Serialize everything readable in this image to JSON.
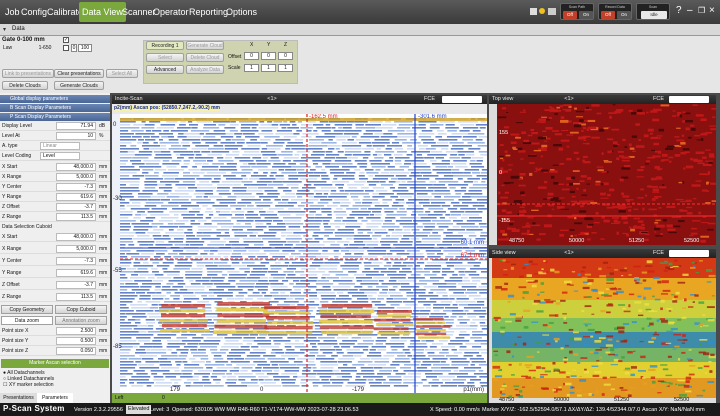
{
  "menu": {
    "items": [
      "Job",
      "Config",
      "Calibrate",
      "Data View",
      "Scanner",
      "Operator",
      "Reporting",
      "Options"
    ],
    "active": "Data View"
  },
  "top_right": {
    "scan_path": {
      "label": "Scan Path",
      "off": "Off",
      "on": "On"
    },
    "record_data": {
      "label": "Record Data",
      "off": "Off",
      "on": "On"
    },
    "scan": {
      "label": "Scan",
      "value": "Idle"
    }
  },
  "tab": {
    "label": "Data"
  },
  "gate": {
    "title": "Gate 0-100 mm",
    "law_label": "Law",
    "law_value": "1-650",
    "range_from": "0",
    "range_to": "100"
  },
  "presentation_buttons": {
    "link": "Link to presentations",
    "clear": "Clear presentations",
    "select_all": "Select All",
    "delete_clouds": "Delete Clouds",
    "generate_clouds": "Generate Clouds"
  },
  "recording": {
    "label": "Recording 1",
    "generate_cloud": "Generate Cloud",
    "select": "Select",
    "delete_cloud": "Delete Cloud",
    "advanced": "Advanced",
    "analyze": "Analyze Data"
  },
  "transform": {
    "headers": [
      "X",
      "Y",
      "Z"
    ],
    "offset_label": "Offset",
    "offset": [
      "0",
      "0",
      "0"
    ],
    "scale_label": "Scale",
    "scale": [
      "1",
      "1",
      "1"
    ]
  },
  "left_panel": {
    "sections": [
      "Global display parameters",
      "B Scan Display Parameters",
      "P Scan Display Parameters"
    ],
    "display_level": {
      "label": "Display Level",
      "value": "71.94",
      "unit": "dB"
    },
    "level_at": {
      "label": "Level At",
      "value": "10",
      "unit": "%"
    },
    "a_type": {
      "label": "A. type",
      "value": "Linear"
    },
    "level_coding": {
      "label": "Level Coding",
      "value": "Level"
    },
    "view_params": [
      {
        "label": "X Start",
        "value": "48,000.0",
        "unit": "mm"
      },
      {
        "label": "X Range",
        "value": "5,000.0",
        "unit": "mm"
      },
      {
        "label": "Y Center",
        "value": "-7.3",
        "unit": "mm"
      },
      {
        "label": "Y Range",
        "value": "619.6",
        "unit": "mm"
      },
      {
        "label": "Z Offset",
        "value": "-3.7",
        "unit": "mm"
      },
      {
        "label": "Z Range",
        "value": "113.5",
        "unit": "mm"
      }
    ],
    "cuboid_title": "Data Selection Cuboid",
    "cuboid_params": [
      {
        "label": "X Start",
        "value": "48,000.0",
        "unit": "mm"
      },
      {
        "label": "X Range",
        "value": "5,000.0",
        "unit": "mm"
      },
      {
        "label": "Y Center",
        "value": "-7.3",
        "unit": "mm"
      },
      {
        "label": "Y Range",
        "value": "619.6",
        "unit": "mm"
      },
      {
        "label": "Z Offset",
        "value": "-3.7",
        "unit": "mm"
      },
      {
        "label": "Z Range",
        "value": "113.5",
        "unit": "mm"
      }
    ],
    "copy_geometry": "Copy Geometry",
    "copy_cuboid": "Copy Cuboid",
    "data_zoom": "Data zoom",
    "annotation_zoom": "Annotation zoom",
    "point_sizes": [
      {
        "label": "Point size X",
        "value": "2.500",
        "unit": "mm"
      },
      {
        "label": "Point size Y",
        "value": "0.500",
        "unit": "mm"
      },
      {
        "label": "Point size Z",
        "value": "0.050",
        "unit": "mm"
      }
    ],
    "marker_header": "Marker Ascan selection",
    "marker_options": [
      "All Datachannels",
      "Linked Datachannels",
      "XY marker selection"
    ],
    "bottom_tabs": [
      "Presentations",
      "Parameters"
    ]
  },
  "bscan": {
    "title": "Incite-Scan",
    "page": "<1>",
    "pos_text": "p2(mm) Ascan pos: (52850.7,247.2,-90.2) mm",
    "fce": "FCE",
    "cursor_left": "-162.5 mm",
    "cursor_right": "-301.6 mm",
    "depth1": "60.1 mm",
    "depth2": "67.1 mm",
    "y_ticks": [
      "0",
      "-30",
      "-55",
      "-85"
    ],
    "x_ticks": [
      "179",
      "0",
      "-179"
    ],
    "x_unit": "p1(mm)",
    "left_label": "Left",
    "left_value": "0"
  },
  "topview": {
    "title": "Top view",
    "page": "<1>",
    "fce": "FCE",
    "y_ticks": [
      "155",
      "0",
      "-155"
    ],
    "x_ticks": [
      "48750",
      "50000",
      "51250",
      "52500"
    ]
  },
  "sideview": {
    "title": "Side view",
    "page": "<1>",
    "fce": "FCE",
    "x_ticks": [
      "48750",
      "50000",
      "51250",
      "52500"
    ]
  },
  "status": {
    "app": "P-Scan System",
    "version": "Version 2.3.2.29556",
    "level_tag": "Elevated",
    "level_text": "Level: 3",
    "opened": "Opened: 630105 WW MW R48-R60 T1-V174-WW-MW 2023-07-28 23.06.53",
    "speed": "X Speed: 0.00 mm/s",
    "marker": "Marker X/Y/Z: -162.5/52594.0/57.1",
    "delta": "ΔX/ΔY/ΔZ: 139.4/52344.0/7.0",
    "ascan": "Ascan X/Y: NaN/NaN mm"
  },
  "colors": {
    "accent_green": "#7aa83c",
    "panel_header_blue": "#5a76a4",
    "cursor_red": "#e02020",
    "cursor_blue": "#2040d0"
  }
}
